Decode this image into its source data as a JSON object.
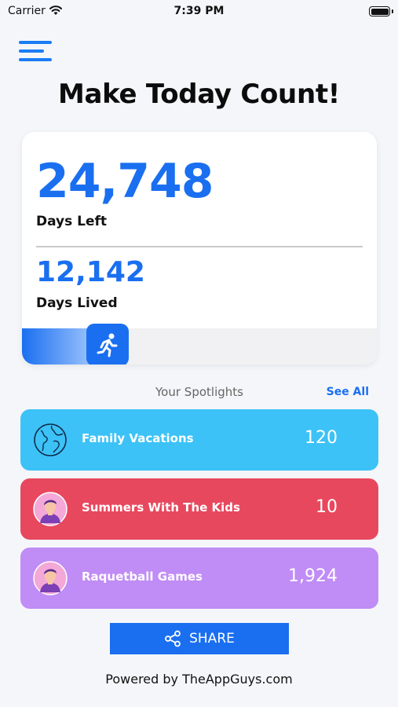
{
  "status": {
    "carrier": "Carrier",
    "time": "7:39 PM"
  },
  "header": {
    "title": "Make Today Count!"
  },
  "stats": {
    "days_left_value": "24,748",
    "days_left_label": "Days Left",
    "days_lived_value": "12,142",
    "days_lived_label": "Days Lived",
    "progress_fraction": 0.33
  },
  "spotlights": {
    "title": "Your Spotlights",
    "see_all": "See All",
    "items": [
      {
        "name": "Family Vacations",
        "count": "120",
        "color": "#3cc2f7",
        "icon": "globe-icon"
      },
      {
        "name": "Summers With The Kids",
        "count": "10",
        "color": "#e8485d",
        "icon": "avatar-icon"
      },
      {
        "name": "Raquetball Games",
        "count": "1,924",
        "color": "#c08cf5",
        "icon": "avatar-icon"
      }
    ]
  },
  "share": {
    "label": "SHARE"
  },
  "footer": {
    "text": "Powered by TheAppGuys.com"
  },
  "colors": {
    "accent": "#1a6ff0",
    "background": "#f5f6fa"
  }
}
